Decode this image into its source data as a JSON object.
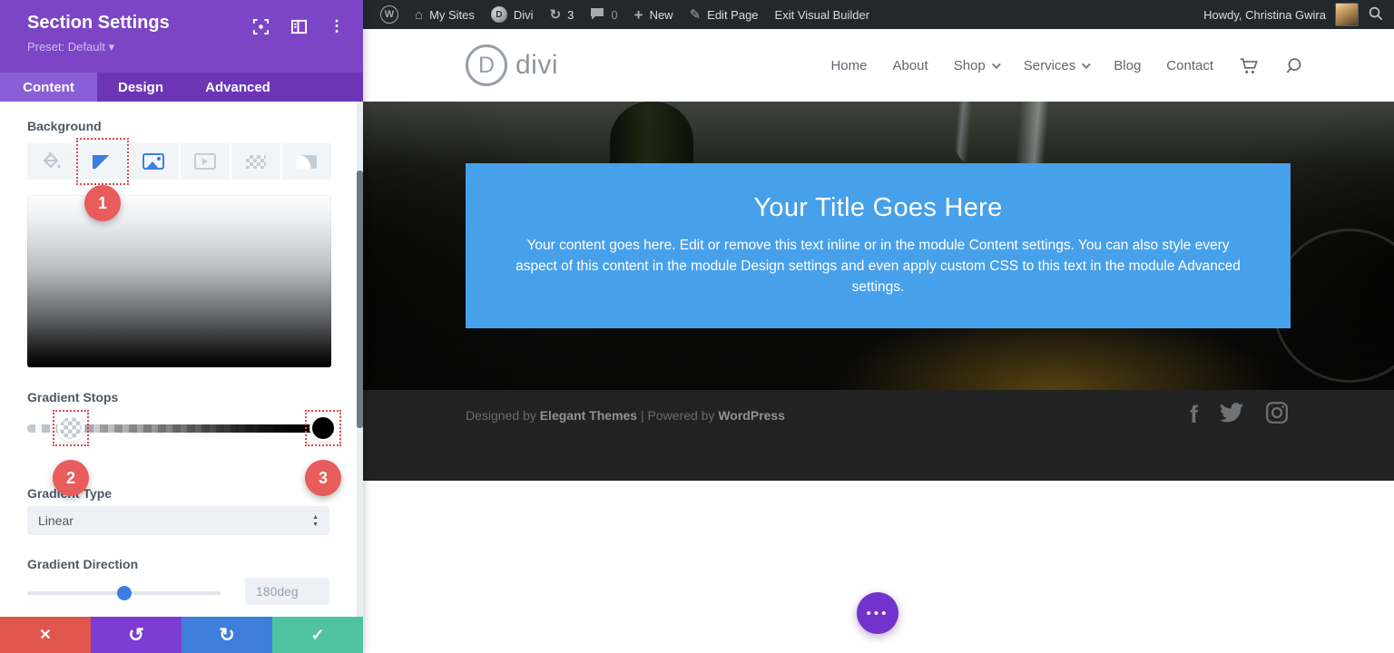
{
  "colors": {
    "builder_purple": "#7b45c5",
    "builder_purple_dark": "#6c35b6",
    "builder_purple_light": "#8a5ed6",
    "accent_blue": "#3b7de4",
    "annotation_red": "#e85c5c",
    "close_red": "#e0564f",
    "undo_purple": "#7c3bd3",
    "redo_blue": "#3e7dda",
    "save_green": "#4fc3a0",
    "hero_blue": "#47a0ea",
    "adminbar_bg": "#23282d",
    "footer_bg": "#222222"
  },
  "admin_bar": {
    "wp_logo": "W",
    "my_sites_label": "My Sites",
    "divi_label": "Divi",
    "divi_logo_letter": "D",
    "updates_count": "3",
    "comments_count": "0",
    "new_label": "New",
    "edit_page_label": "Edit Page",
    "exit_label": "Exit Visual Builder",
    "howdy_label": "Howdy, Christina Gwira"
  },
  "settings_panel": {
    "title": "Section Settings",
    "preset_label": "Preset: Default",
    "tabs": [
      {
        "label": "Content"
      },
      {
        "label": "Design"
      },
      {
        "label": "Advanced"
      }
    ],
    "active_tab": "Content",
    "background_label": "Background",
    "gradient_stops_label": "Gradient Stops",
    "gradient_type_label": "Gradient Type",
    "gradient_type_value": "Linear",
    "gradient_direction_label": "Gradient Direction",
    "gradient_direction_value": "180deg",
    "annotations": {
      "step1": "1",
      "step2": "2",
      "step3": "3"
    }
  },
  "site": {
    "logo_letter": "D",
    "logo_text": "divi",
    "nav": [
      {
        "label": "Home"
      },
      {
        "label": "About"
      },
      {
        "label": "Shop"
      },
      {
        "label": "Services"
      },
      {
        "label": "Blog"
      },
      {
        "label": "Contact"
      }
    ],
    "hero": {
      "title": "Your Title Goes Here",
      "body": "Your content goes here. Edit or remove this text inline or in the module Content settings. You can also style every aspect of this content in the module Design settings and even apply custom CSS to this text in the module Advanced settings."
    },
    "footer": {
      "designed_by": "Designed by",
      "brand": "Elegant Themes",
      "separator": "|",
      "powered_by": "Powered by",
      "platform": "WordPress"
    }
  },
  "icons": {
    "kebab": "⋮",
    "preset_caret": "▾",
    "close": "✕",
    "undo": "↺",
    "redo": "↻",
    "check": "✓",
    "plus": "+",
    "my_sites_glyph": "⌂",
    "pencil_glyph": "✎",
    "refresh_glyph": "↻",
    "facebook_glyph": "f",
    "ellipsis_dots": "•••"
  }
}
